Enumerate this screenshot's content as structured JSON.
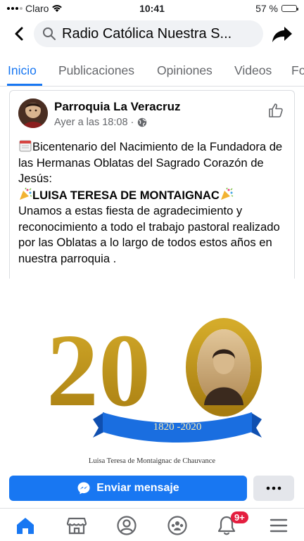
{
  "status_bar": {
    "carrier": "Claro",
    "time": "10:41",
    "battery": "57 %"
  },
  "header": {
    "search_text": "Radio Católica Nuestra S..."
  },
  "tabs": [
    {
      "label": "Inicio",
      "active": true
    },
    {
      "label": "Publicaciones"
    },
    {
      "label": "Opiniones"
    },
    {
      "label": "Videos"
    },
    {
      "label": "Fo"
    }
  ],
  "post": {
    "author": "Parroquia La Veracruz",
    "time": "Ayer a las 18:08 ·",
    "paragraphs": [
      "Bicentenario del Nacimiento de la Fundadora de las Hermanas Oblatas del Sagrado Corazón de Jesús:",
      "LUISA TERESA DE MONTAIGNAC",
      "Unamos a estas fiesta de agradecimiento y reconocimiento a todo el trabajo pastoral realizado por las Oblatas a lo largo de todos estos años en nuestra parroquia ."
    ]
  },
  "image": {
    "number_left": "20",
    "ribbon_text": "1820 -2020",
    "caption": "Luisa Teresa de Montaignac de Chauvance"
  },
  "actions": {
    "message_button": "Enviar mensaje"
  },
  "bottom_nav": {
    "notifications_badge": "9+"
  },
  "colors": {
    "accent": "#1877f2",
    "gold": "#c49a17",
    "ribbon": "#1a6ee0"
  }
}
